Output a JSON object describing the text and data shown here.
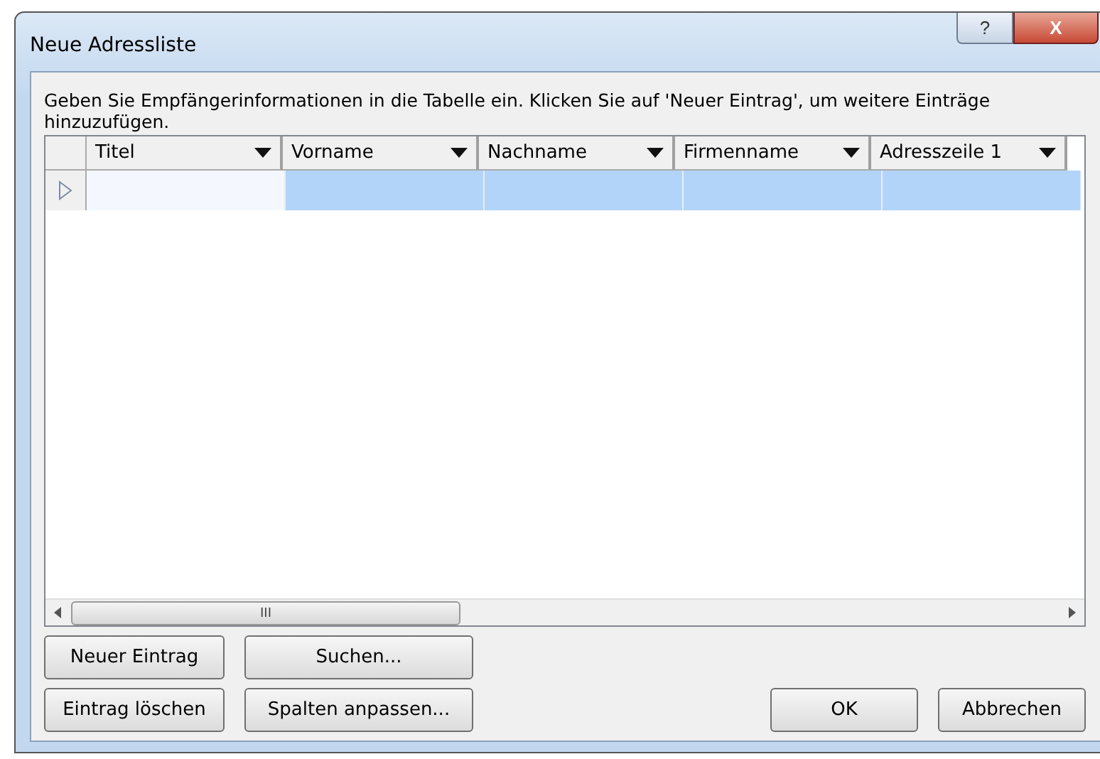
{
  "window": {
    "title": "Neue Adressliste",
    "help_button": "?",
    "close_button": "X"
  },
  "instruction": "Geben Sie Empfängerinformationen in die Tabelle ein. Klicken Sie auf 'Neuer Eintrag', um weitere Einträge hinzuzufügen.",
  "table": {
    "columns": [
      "Titel",
      "Vorname",
      "Nachname",
      "Firmenname",
      "Adresszeile 1"
    ],
    "rows": [
      {
        "selected": true,
        "cells": [
          "",
          "",
          "",
          "",
          ""
        ]
      }
    ]
  },
  "scrollbar_grip": "III",
  "buttons_left": [
    [
      "Neuer Eintrag",
      "Suchen..."
    ],
    [
      "Eintrag löschen",
      "Spalten anpassen..."
    ]
  ],
  "buttons_right": [
    "OK",
    "Abbrechen"
  ]
}
